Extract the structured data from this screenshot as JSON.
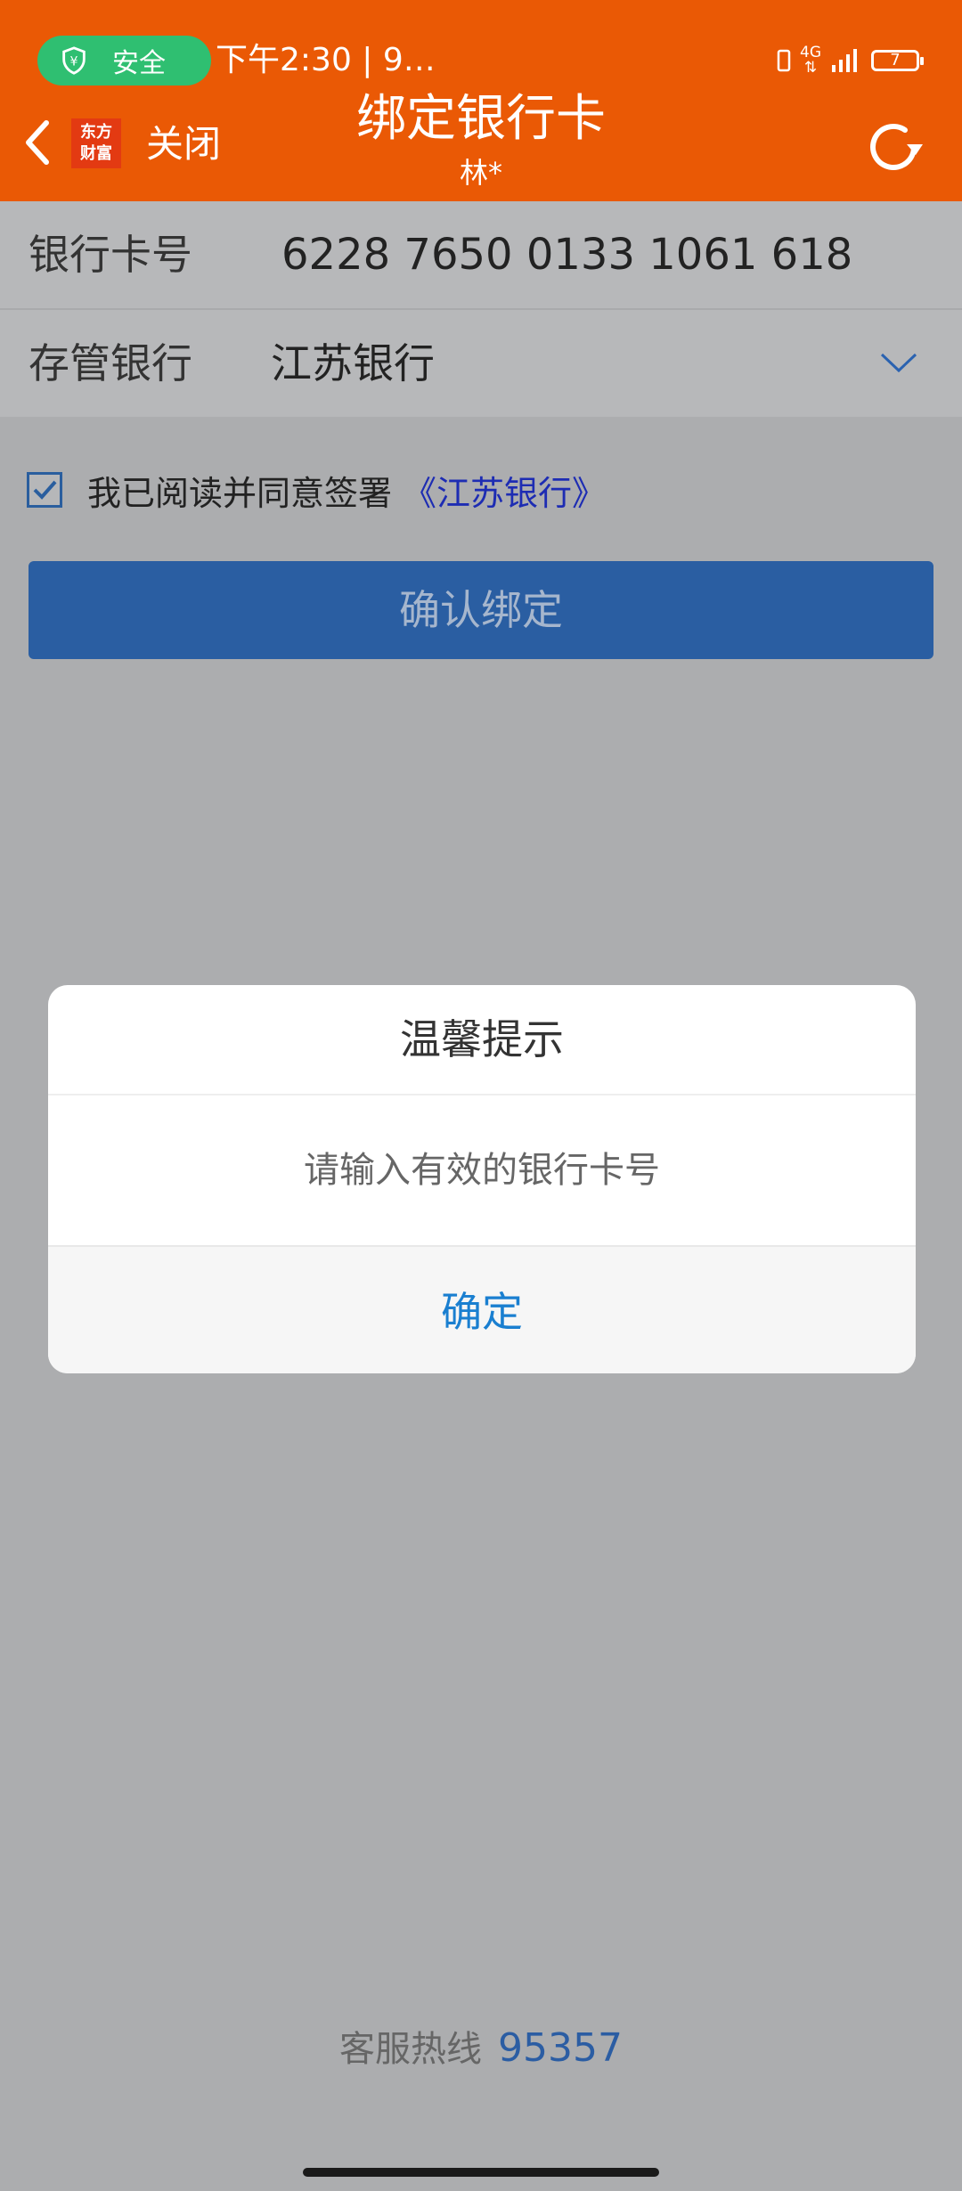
{
  "status_bar": {
    "security_badge": "安全",
    "time": "下午2:30 | 9…",
    "network": "4G",
    "battery": "7"
  },
  "nav": {
    "logo_text_line1": "东方",
    "logo_text_line2": "财富",
    "close_label": "关闭",
    "title": "绑定银行卡",
    "subtitle": "林*"
  },
  "form": {
    "card_number_label": "银行卡号",
    "card_number_value": "6228 7650 0133 1061 618",
    "bank_label": "存管银行",
    "bank_value": "江苏银行"
  },
  "agreement": {
    "text": "我已阅读并同意签署",
    "link": "《江苏银行》",
    "checked": true
  },
  "confirm_button": "确认绑定",
  "dialog": {
    "title": "温馨提示",
    "message": "请输入有效的银行卡号",
    "ok": "确定"
  },
  "hotline": {
    "label": "客服热线",
    "number": "95357"
  },
  "colors": {
    "header": "#ea5905",
    "primary_button": "#2a5ea2",
    "dialog_action": "#1a7fd0"
  }
}
